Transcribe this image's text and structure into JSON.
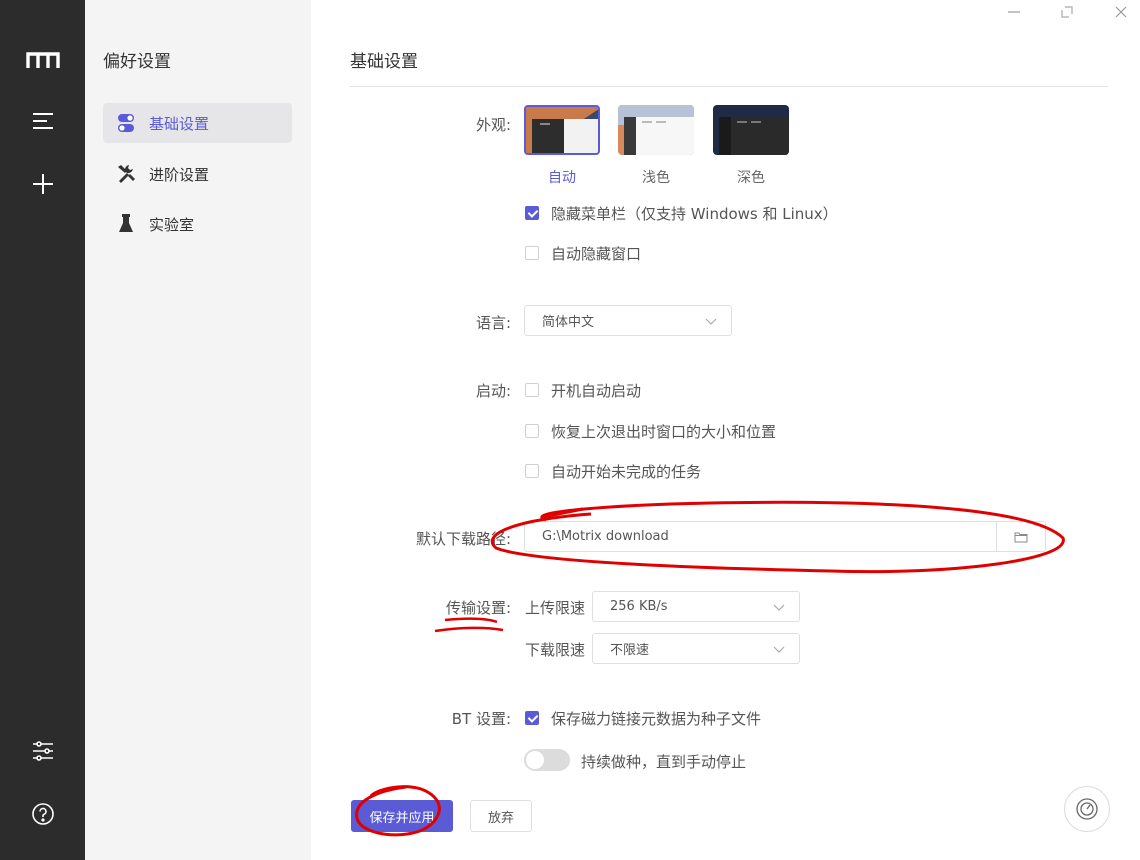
{
  "sidebar": {
    "logo": "motrix-logo",
    "icons": [
      "menu-icon",
      "plus-icon",
      "sliders-icon",
      "help-icon"
    ]
  },
  "subnav": {
    "title": "偏好设置",
    "items": [
      {
        "label": "基础设置",
        "icon": "toggle-icon",
        "active": true
      },
      {
        "label": "进阶设置",
        "icon": "tools-icon",
        "active": false
      },
      {
        "label": "实验室",
        "icon": "flask-icon",
        "active": false
      }
    ]
  },
  "window_controls": [
    "minimize-icon",
    "restore-icon",
    "close-icon"
  ],
  "page": {
    "title": "基础设置",
    "appearance": {
      "label": "外观:",
      "themes": [
        {
          "label": "自动",
          "selected": true
        },
        {
          "label": "浅色",
          "selected": false
        },
        {
          "label": "深色",
          "selected": false
        }
      ],
      "hide_menu": {
        "label": "隐藏菜单栏（仅支持 Windows 和 Linux）",
        "checked": true
      },
      "auto_hide_window": {
        "label": "自动隐藏窗口",
        "checked": false
      }
    },
    "language": {
      "label": "语言:",
      "value": "简体中文"
    },
    "startup": {
      "label": "启动:",
      "options": [
        {
          "label": "开机自动启动",
          "checked": false
        },
        {
          "label": "恢复上次退出时窗口的大小和位置",
          "checked": false
        },
        {
          "label": "自动开始未完成的任务",
          "checked": false
        }
      ]
    },
    "download_path": {
      "label": "默认下载路径:",
      "value": "G:\\Motrix download",
      "icon": "folder-icon"
    },
    "transfer": {
      "label": "传输设置:",
      "upload": {
        "label": "上传限速",
        "value": "256 KB/s"
      },
      "download": {
        "label": "下载限速",
        "value": "不限速"
      }
    },
    "bt": {
      "label": "BT 设置:",
      "save_magnet": {
        "label": "保存磁力链接元数据为种子文件",
        "checked": true
      },
      "keep_seeding": {
        "label": "持续做种，直到手动停止",
        "on": false
      }
    },
    "buttons": {
      "save": "保存并应用",
      "discard": "放弃"
    },
    "speedometer_icon": "speedometer-icon"
  },
  "colors": {
    "accent": "#5b5bd6",
    "rail": "#2c2c2c",
    "subnav": "#f4f4f5",
    "annotation": "#e00000"
  }
}
